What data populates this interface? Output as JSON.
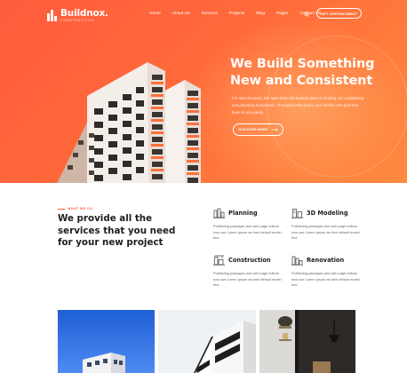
{
  "header": {
    "logo_name": "Buildnox.",
    "logo_sub": "CONSTRUCTION",
    "nav": [
      "Home",
      "About Us",
      "Services",
      "Projects",
      "Blog",
      "Pages",
      "Contact Us"
    ],
    "cta_label": "GET APPOINTMENT"
  },
  "hero": {
    "title_line1": "We Build Something",
    "title_line2": "New and Consistent",
    "text": "For over 80 years, We have been the trusted name in heating, air conditioning and plumbing businesses. Throughout the years, our number one goal has been to accurately.",
    "button_label": "DISCOVER MORE"
  },
  "services": {
    "eyebrow": "WHAT WE DO",
    "title": "We provide all the services that you need for your new project",
    "items": [
      {
        "name": "Planning",
        "text": "Publishing packages and web page editors now use Lorem Ipsum as their default model text."
      },
      {
        "name": "3D Modeling",
        "text": "Publishing packages and web page editors now use Lorem Ipsum as their default model text."
      },
      {
        "name": "Construction",
        "text": "Publishing packages and web page editors now use Lorem Ipsum as their default model text."
      },
      {
        "name": "Renovation",
        "text": "Publishing packages and web page editors now use Lorem Ipsum as their default model text."
      }
    ]
  },
  "colors": {
    "accent": "#ff5b3d",
    "hero_gradient_end": "#ff8a3f",
    "heading": "#1d1d1d"
  }
}
